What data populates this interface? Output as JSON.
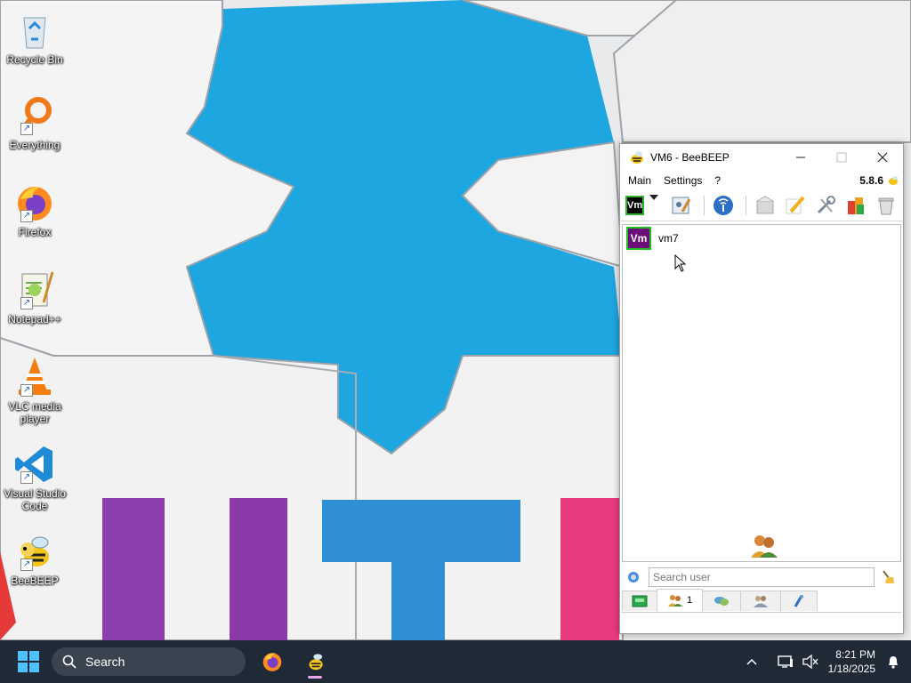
{
  "desktop": {
    "icons": [
      {
        "label": "Recycle Bin",
        "icon": "recycle-bin-icon",
        "shortcut": false
      },
      {
        "label": "Everything",
        "icon": "everything-search-icon",
        "shortcut": true
      },
      {
        "label": "Firefox",
        "icon": "firefox-icon",
        "shortcut": true
      },
      {
        "label": "Notepad++",
        "icon": "notepad-plus-plus-icon",
        "shortcut": true
      },
      {
        "label": "VLC media player",
        "icon": "vlc-icon",
        "shortcut": true
      },
      {
        "label": "Visual Studio Code",
        "icon": "vscode-icon",
        "shortcut": true
      },
      {
        "label": "BeeBEEP",
        "icon": "beebeep-icon",
        "shortcut": true
      }
    ]
  },
  "window": {
    "title": "VM6 - BeeBEEP",
    "menu": [
      "Main",
      "Settings",
      "?"
    ],
    "version": "5.8.6",
    "toolbar_badge": "Vm",
    "users": [
      {
        "avatar": "Vm",
        "name": "vm7"
      }
    ],
    "search": {
      "placeholder": "Search user",
      "value": ""
    },
    "tabs": [
      {
        "icon": "chat-list-icon",
        "count": ""
      },
      {
        "icon": "users-icon",
        "count": "1"
      },
      {
        "icon": "chats-icon",
        "count": ""
      },
      {
        "icon": "groups-icon",
        "count": ""
      },
      {
        "icon": "files-icon",
        "count": ""
      }
    ]
  },
  "taskbar": {
    "search_label": "Search",
    "time": "8:21 PM",
    "date": "1/18/2025"
  },
  "colors": {
    "taskbar_bg": "#1f2a36",
    "puzzle_blue": "#1ea6e0",
    "avatar_purple": "#6b0d7a",
    "avatar_border": "#22bb22"
  }
}
